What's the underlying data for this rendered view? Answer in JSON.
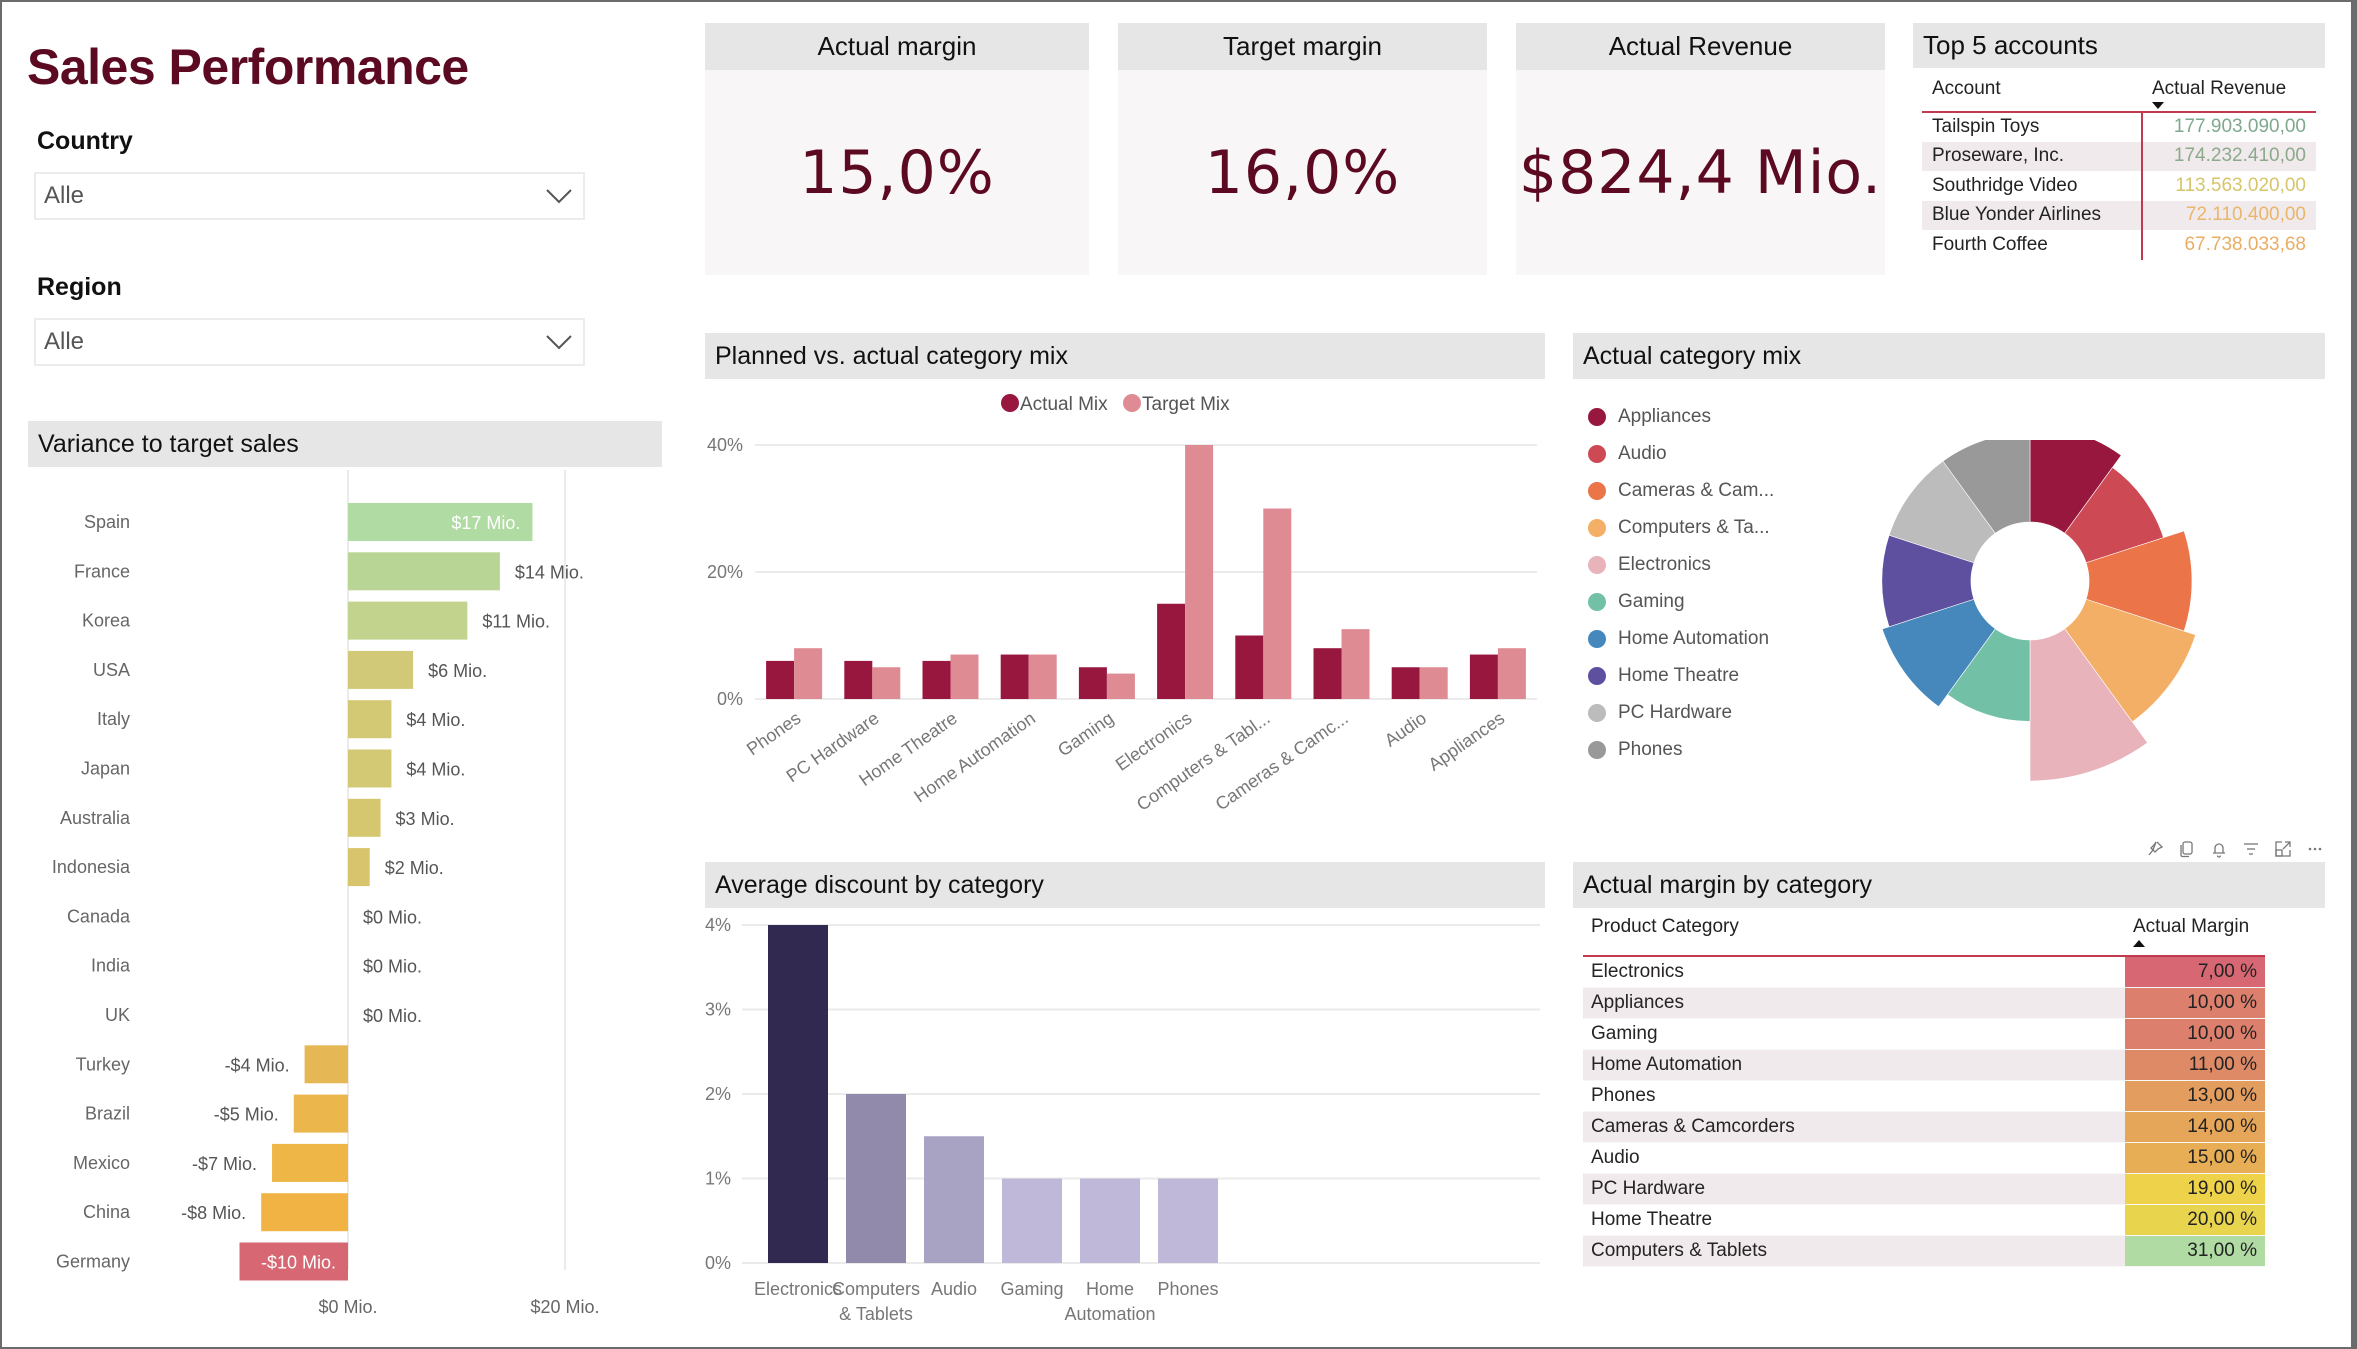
{
  "page": {
    "title": "Sales Performance"
  },
  "slicers": {
    "country": {
      "label": "Country",
      "value": "Alle"
    },
    "region": {
      "label": "Region",
      "value": "Alle"
    }
  },
  "kpis": [
    {
      "label": "Actual margin",
      "value": "15,0%"
    },
    {
      "label": "Target margin",
      "value": "16,0%"
    },
    {
      "label": "Actual Revenue",
      "value": "$824,4 Mio."
    }
  ],
  "top_accounts": {
    "title": "Top 5 accounts",
    "columns": [
      "Account",
      "Actual Revenue"
    ],
    "sort": "descending",
    "rows": [
      {
        "account": "Tailspin Toys",
        "revenue": "177.903.090,00",
        "color": "#7fa88c"
      },
      {
        "account": "Proseware, Inc.",
        "revenue": "174.232.410,00",
        "color": "#8ca98a"
      },
      {
        "account": "Southridge Video",
        "revenue": "113.563.020,00",
        "color": "#d6c56a"
      },
      {
        "account": "Blue Yonder Airlines",
        "revenue": "72.110.400,00",
        "color": "#eab66a"
      },
      {
        "account": "Fourth Coffee",
        "revenue": "67.738.033,68",
        "color": "#e9ad63"
      }
    ]
  },
  "visual_header_icons": [
    "pin-icon",
    "copy-icon",
    "alert-bell-icon",
    "filter-icon",
    "focus-mode-icon",
    "more-options-icon"
  ],
  "colors": {
    "brand": "#5c0a22",
    "actual_mix": "#97173f",
    "target_mix": "#df8b94",
    "header_bg": "#e6e6e6",
    "table_rule": "#c23a4f"
  },
  "chart_data": [
    {
      "id": "variance",
      "type": "bar",
      "orientation": "horizontal",
      "title": "Variance to target sales",
      "categories": [
        "Spain",
        "France",
        "Korea",
        "USA",
        "Italy",
        "Japan",
        "Australia",
        "Indonesia",
        "Canada",
        "India",
        "UK",
        "Turkey",
        "Brazil",
        "Mexico",
        "China",
        "Germany"
      ],
      "values": [
        17,
        14,
        11,
        6,
        4,
        4,
        3,
        2,
        0,
        0,
        0,
        -4,
        -5,
        -7,
        -8,
        -10
      ],
      "labels": [
        "$17 Mio.",
        "$14 Mio.",
        "$11 Mio.",
        "$6 Mio.",
        "$4 Mio.",
        "$4 Mio.",
        "$3 Mio.",
        "$2 Mio.",
        "$0 Mio.",
        "$0 Mio.",
        "$0 Mio.",
        "-$4 Mio.",
        "-$5 Mio.",
        "-$7 Mio.",
        "-$8 Mio.",
        "-$10 Mio."
      ],
      "colors": [
        "#b0dba3",
        "#b9d596",
        "#c2d38d",
        "#d1c977",
        "#d3c874",
        "#d3c874",
        "#d5c670",
        "#d7c46c",
        "#d8c46c",
        "#d8c46c",
        "#d8c46c",
        "#e6b855",
        "#ebb74c",
        "#eeb547",
        "#f0b344",
        "#d76873"
      ],
      "xticks": [
        {
          "value": 0,
          "label": "$0 Mio."
        },
        {
          "value": 20,
          "label": "$20 Mio."
        }
      ],
      "xlim": [
        -14,
        25
      ],
      "unit": "Mio. $",
      "grid": true
    },
    {
      "id": "category_mix",
      "type": "bar",
      "title": "Planned vs. actual category mix",
      "categories": [
        "Phones",
        "PC Hardware",
        "Home Theatre",
        "Home Automation",
        "Gaming",
        "Electronics",
        "Computers & Tabl...",
        "Cameras & Camc...",
        "Audio",
        "Appliances"
      ],
      "series": [
        {
          "name": "Actual Mix",
          "color": "#97173f",
          "values": [
            6,
            6,
            6,
            7,
            5,
            15,
            10,
            8,
            5,
            7
          ]
        },
        {
          "name": "Target Mix",
          "color": "#df8b94",
          "values": [
            8,
            5,
            7,
            7,
            4,
            40,
            30,
            11,
            5,
            8
          ]
        }
      ],
      "yticks": [
        "0%",
        "20%",
        "40%"
      ],
      "ylim": [
        0,
        40
      ],
      "legend": "top-center",
      "grid": true
    },
    {
      "id": "actual_category_mix",
      "type": "pie",
      "variant": "polar-area",
      "title": "Actual category mix",
      "categories": [
        "Appliances",
        "Audio",
        "Cameras & Cam...",
        "Computers & Ta...",
        "Electronics",
        "Gaming",
        "Home Automation",
        "Home Theatre",
        "PC Hardware",
        "Phones"
      ],
      "values": [
        7,
        5,
        8,
        10,
        15,
        5,
        7,
        6,
        6,
        6
      ],
      "colors": [
        "#97173f",
        "#cd4a54",
        "#eb7449",
        "#f4af66",
        "#e8b3ba",
        "#72c1a6",
        "#4688bb",
        "#5f4f9f",
        "#bcbcbc",
        "#999999"
      ],
      "legend": "left"
    },
    {
      "id": "avg_discount",
      "type": "bar",
      "title": "Average discount by category",
      "categories": [
        "Electronics",
        "Computers & Tablets",
        "Audio",
        "Gaming",
        "Home Automation",
        "Phones"
      ],
      "values": [
        4,
        2,
        1.5,
        1,
        1,
        1
      ],
      "colors": [
        "#312950",
        "#918aaa",
        "#a9a3c3",
        "#c0b8d8",
        "#c0b8d8",
        "#c0b8d8"
      ],
      "yticks": [
        "0%",
        "1%",
        "2%",
        "3%",
        "4%"
      ],
      "ylim": [
        0,
        4
      ],
      "grid": true
    }
  ],
  "margin_table": {
    "title": "Actual margin by category",
    "columns": [
      "Product Category",
      "Actual Margin"
    ],
    "sort": "ascending",
    "rows": [
      {
        "category": "Electronics",
        "margin": "7,00 %",
        "color": "#d76873"
      },
      {
        "category": "Appliances",
        "margin": "10,00 %",
        "color": "#dc7f6c"
      },
      {
        "category": "Gaming",
        "margin": "10,00 %",
        "color": "#dc7f6c"
      },
      {
        "category": "Home Automation",
        "margin": "11,00 %",
        "color": "#df8a67"
      },
      {
        "category": "Phones",
        "margin": "13,00 %",
        "color": "#e39d5f"
      },
      {
        "category": "Cameras & Camcorders",
        "margin": "14,00 %",
        "color": "#e5a65a"
      },
      {
        "category": "Audio",
        "margin": "15,00 %",
        "color": "#e7ae55"
      },
      {
        "category": "PC Hardware",
        "margin": "19,00 %",
        "color": "#eed34a"
      },
      {
        "category": "Home Theatre",
        "margin": "20,00 %",
        "color": "#e9d44e"
      },
      {
        "category": "Computers & Tablets",
        "margin": "31,00 %",
        "color": "#b0dba3"
      }
    ]
  }
}
